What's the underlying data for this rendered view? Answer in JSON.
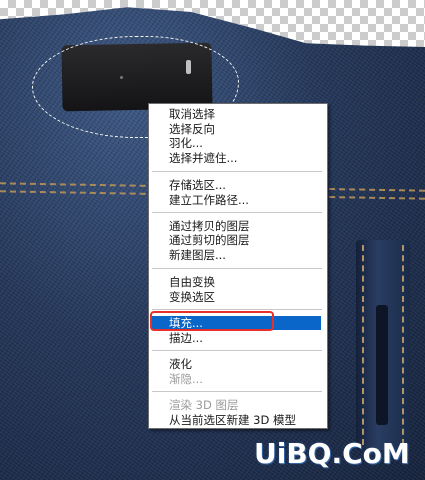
{
  "context_menu": {
    "groups": [
      {
        "items": [
          {
            "label": "取消选择",
            "enabled": true
          },
          {
            "label": "选择反向",
            "enabled": true
          },
          {
            "label": "羽化...",
            "enabled": true
          },
          {
            "label": "选择并遮住...",
            "enabled": true
          }
        ]
      },
      {
        "items": [
          {
            "label": "存储选区...",
            "enabled": true
          },
          {
            "label": "建立工作路径...",
            "enabled": true
          }
        ]
      },
      {
        "items": [
          {
            "label": "通过拷贝的图层",
            "enabled": true
          },
          {
            "label": "通过剪切的图层",
            "enabled": true
          },
          {
            "label": "新建图层...",
            "enabled": true
          }
        ]
      },
      {
        "items": [
          {
            "label": "自由变换",
            "enabled": true
          },
          {
            "label": "变换选区",
            "enabled": true
          }
        ]
      },
      {
        "items": [
          {
            "label": "填充...",
            "enabled": true,
            "highlighted": true
          },
          {
            "label": "描边...",
            "enabled": true
          }
        ]
      },
      {
        "items": [
          {
            "label": "液化",
            "enabled": true
          },
          {
            "label": "渐隐...",
            "enabled": false
          }
        ]
      },
      {
        "items": [
          {
            "label": "渲染 3D 图层",
            "enabled": false
          },
          {
            "label": "从当前选区新建 3D 模型",
            "enabled": true
          }
        ]
      }
    ],
    "highlight_color": "#0a66c8",
    "annotation_color": "#e8302a"
  },
  "watermark": {
    "text": "UiBQ.CoM",
    "color": "#ffffff"
  },
  "canvas": {
    "image_subject": "denim-jeans-icon",
    "selection": "marching-ants-marquee"
  }
}
